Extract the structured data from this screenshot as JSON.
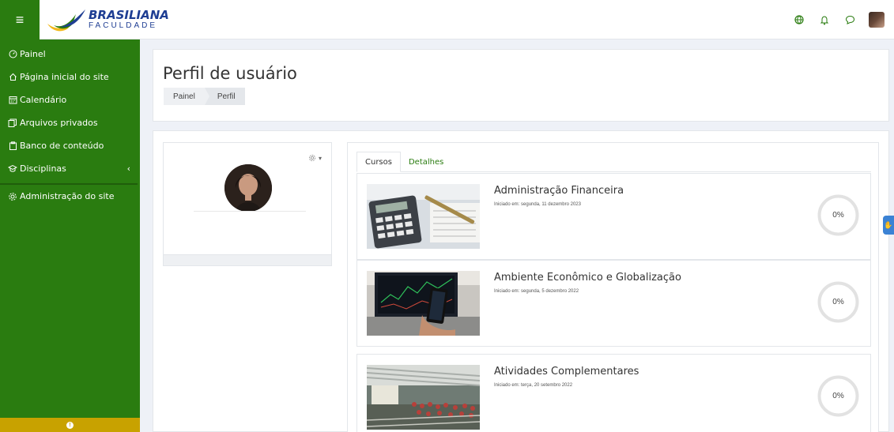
{
  "brand": {
    "line1": "BRASILIANA",
    "line2": "FACULDADE",
    "color": "#1f3e93",
    "accent": "#2a7c10"
  },
  "topbar": {
    "menu_icon": "hamburger-icon",
    "icons": [
      "globe-icon",
      "bell-icon",
      "chat-icon",
      "user-avatar"
    ]
  },
  "sidebar": {
    "items": [
      {
        "label": "Painel",
        "icon": "dashboard-icon"
      },
      {
        "label": "Página inicial do site",
        "icon": "home-icon"
      },
      {
        "label": "Calendário",
        "icon": "calendar-icon"
      },
      {
        "label": "Arquivos privados",
        "icon": "files-icon"
      },
      {
        "label": "Banco de conteúdo",
        "icon": "clipboard-icon"
      },
      {
        "label": "Disciplinas",
        "icon": "graduation-cap-icon"
      },
      {
        "label": "Administração do site",
        "icon": "gear-icon"
      }
    ],
    "bottom_color": "#c8a200"
  },
  "header": {
    "title": "Perfil de usuário",
    "breadcrumb": [
      "Painel",
      "Perfil"
    ]
  },
  "tabs": [
    {
      "label": "Cursos"
    },
    {
      "label": "Detalhes"
    }
  ],
  "courses": [
    {
      "title": "Administração Financeira",
      "started": "Iniciado em: segunda, 11 dezembro 2023",
      "progress_text": "0%",
      "progress": 0
    },
    {
      "title": "Ambiente Econômico e Globalização",
      "started": "Iniciado em: segunda, 5 dezembro 2022",
      "progress_text": "0%",
      "progress": 0
    },
    {
      "title": "Atividades Complementares",
      "started": "Iniciado em: terça, 20 setembro 2022",
      "progress_text": "0%",
      "progress": 0
    }
  ]
}
